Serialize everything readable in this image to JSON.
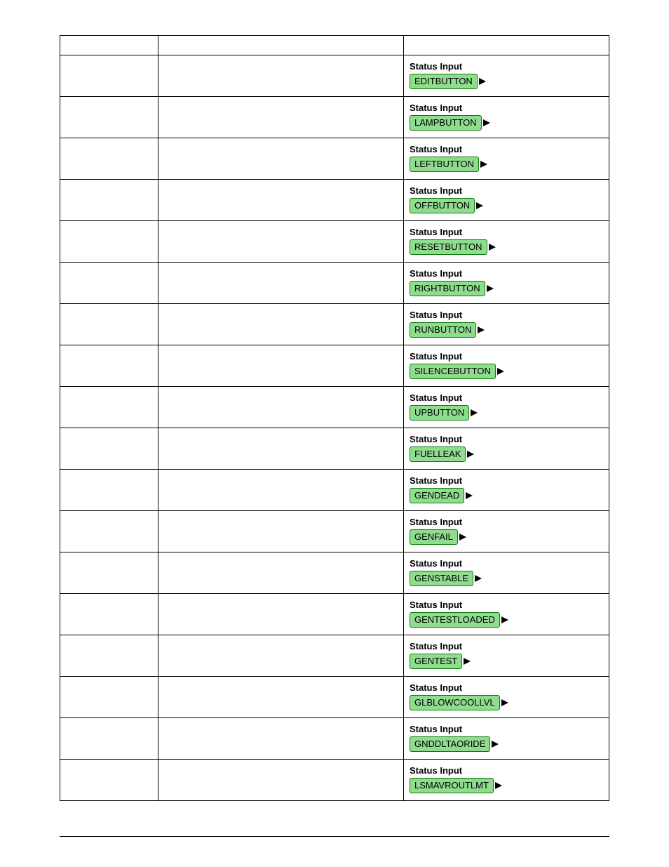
{
  "rows": [
    {
      "label": "Status Input",
      "value": "EDITBUTTON"
    },
    {
      "label": "Status Input",
      "value": "LAMPBUTTON"
    },
    {
      "label": "Status Input",
      "value": "LEFTBUTTON"
    },
    {
      "label": "Status Input",
      "value": "OFFBUTTON"
    },
    {
      "label": "Status Input",
      "value": "RESETBUTTON"
    },
    {
      "label": "Status Input",
      "value": "RIGHTBUTTON"
    },
    {
      "label": "Status Input",
      "value": "RUNBUTTON"
    },
    {
      "label": "Status Input",
      "value": "SILENCEBUTTON"
    },
    {
      "label": "Status Input",
      "value": "UPBUTTON"
    },
    {
      "label": "Status Input",
      "value": "FUELLEAK"
    },
    {
      "label": "Status Input",
      "value": "GENDEAD"
    },
    {
      "label": "Status Input",
      "value": "GENFAIL"
    },
    {
      "label": "Status Input",
      "value": "GENSTABLE"
    },
    {
      "label": "Status Input",
      "value": "GENTESTLOADED"
    },
    {
      "label": "Status Input",
      "value": "GENTEST"
    },
    {
      "label": "Status Input",
      "value": "GLBLOWCOOLLVL"
    },
    {
      "label": "Status Input",
      "value": "GNDDLTAORIDE"
    },
    {
      "label": "Status Input",
      "value": "LSMAVROUTLMT"
    }
  ]
}
